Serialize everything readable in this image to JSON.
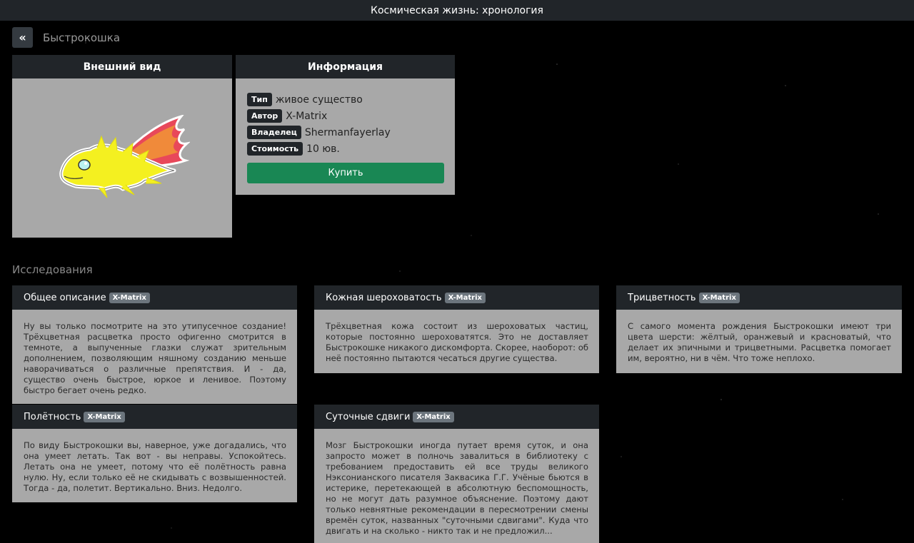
{
  "header": {
    "title": "Космическая жизнь: хронология"
  },
  "nav": {
    "back_icon": "«",
    "breadcrumb": "Быстрокошка"
  },
  "appearance": {
    "title": "Внешний вид"
  },
  "info": {
    "title": "Информация",
    "rows": [
      {
        "label": "Тип",
        "value": "живое существо"
      },
      {
        "label": "Автор",
        "value": "X-Matrix"
      },
      {
        "label": "Владелец",
        "value": "Shermanfayerlay"
      },
      {
        "label": "Стоимость",
        "value": "10 юв."
      }
    ],
    "buy_label": "Купить"
  },
  "research": {
    "title": "Исследования",
    "cards": [
      {
        "title": "Общее описание",
        "author": "X-Matrix",
        "text": "Ну вы только посмотрите на это утипусечное создание! Трёхцветная расцветка просто офигенно смотрится в темноте, а выпученные глазки служат зрительным дополнением, позволяющим няшному созданию меньше наворачиваться о различные препятствия. И - да, существо очень быстрое, юркое и ленивое. Поэтому быстро бегает очень редко."
      },
      {
        "title": "Кожная шероховатость",
        "author": "X-Matrix",
        "text": "Трёхцветная кожа состоит из шероховатых частиц, которые постоянно шероховатятся. Это не доставляет Быстрокошке никакого дискомфорта. Скорее, наоборот: об неё постоянно пытаются чесаться другие существа."
      },
      {
        "title": "Трицветность",
        "author": "X-Matrix",
        "text": "С самого момента рождения Быстрокошки имеют три цвета шерсти: жёлтый, оранжевый и красноватый, что делает их эпичными и трицветными. Расцветка помогает им, вероятно, ни в чём. Что тоже неплохо."
      },
      {
        "title": "Полётность",
        "author": "X-Matrix",
        "text": "По виду Быстрокошки вы, наверное, уже догадались, что она умеет летать. Так вот - вы неправы. Успокойтесь. Летать она не умеет, потому что её полётность равна нулю. Ну, если только её не скидывать с возвышенностей. Тогда - да, полетит. Вертикально. Вниз. Недолго."
      },
      {
        "title": "Суточные сдвиги",
        "author": "X-Matrix",
        "text": "Мозг Быстрокошки иногда путает время суток, и она запросто может в полночь завалиться в библиотеку с требованием предоставить ей все труды великого Нэксонианского писателя Заквасика Г.Г. Учёные бьются в истерике, перетекающей в абсолютную беспомощность, но не могут дать разумное объяснение. Поэтому дают только невнятные рекомендации в пересмотрении смены времён суток, названных \"суточными сдвигами\". Куда что двигать и на сколько - никто так и не предложил..."
      }
    ]
  },
  "colors": {
    "topbar": "#212529",
    "panel": "#a8a8a8",
    "buy": "#198754",
    "badge": "#6c757d"
  }
}
